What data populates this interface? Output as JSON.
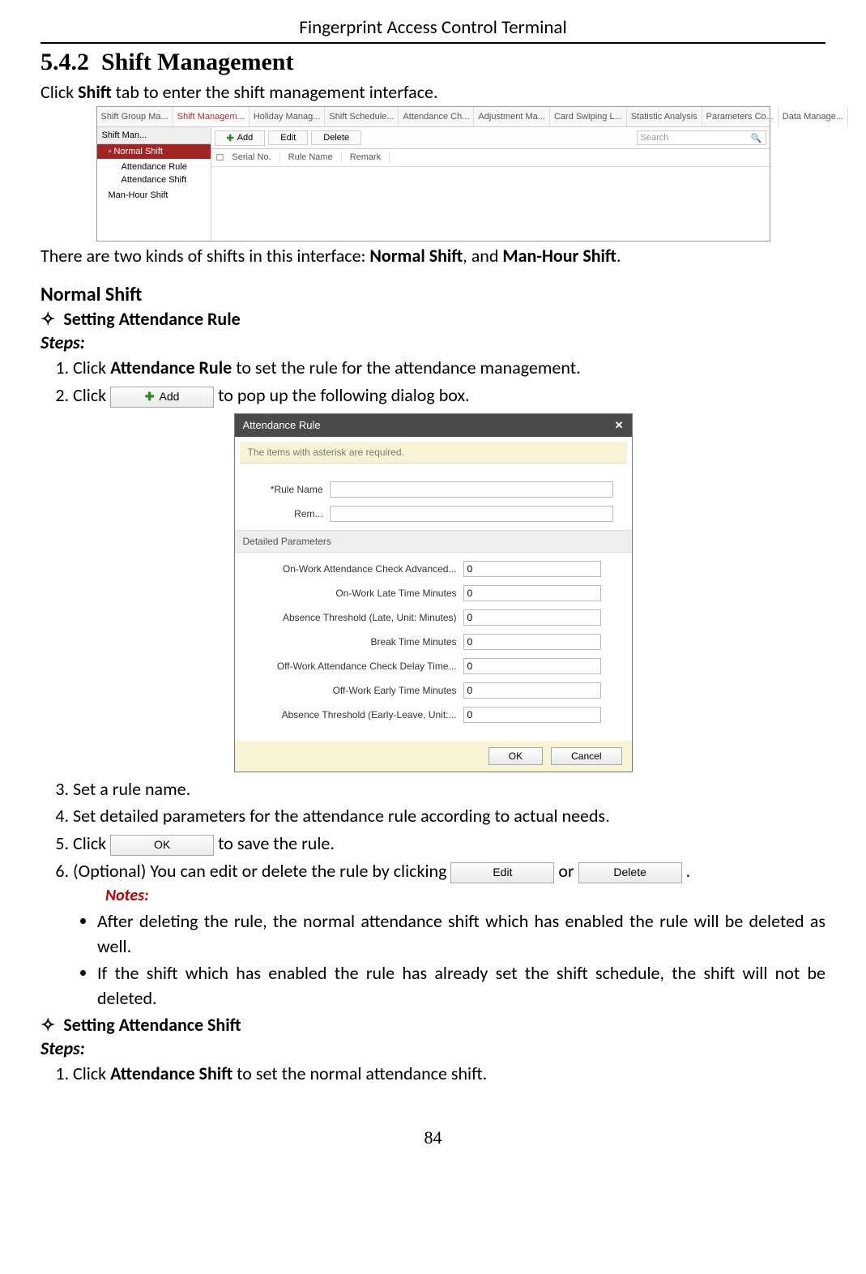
{
  "header": {
    "title": "Fingerprint Access Control Terminal"
  },
  "section": {
    "number": "5.4.2",
    "title": "Shift Management",
    "intro_prefix": "Click ",
    "intro_bold": "Shift",
    "intro_suffix": " tab to enter the shift management interface."
  },
  "shot1": {
    "tabs": [
      "Shift Group Ma...",
      "Shift Managem...",
      "Holiday Manag...",
      "Shift Schedule...",
      "Attendance Ch...",
      "Adjustment Ma...",
      "Card Swiping L...",
      "Statistic Analysis",
      "Parameters Co...",
      "Data Manage..."
    ],
    "active_tab_index": 1,
    "left_header": "Shift Man...",
    "tree": {
      "root": "Normal Shift",
      "children": [
        "Attendance Rule",
        "Attendance Shift"
      ],
      "sibling": "Man-Hour Shift"
    },
    "toolbar": {
      "add": "Add",
      "edit": "Edit",
      "delete": "Delete",
      "search_placeholder": "Search"
    },
    "columns": [
      "Serial No.",
      "Rule Name",
      "Remark"
    ]
  },
  "after_shot1": {
    "prefix": "There are two kinds of shifts in this interface: ",
    "b1": "Normal Shift",
    "mid": ", and ",
    "b2": "Man-Hour Shift",
    "suffix": "."
  },
  "normal_shift_heading": "Normal Shift",
  "setting_rule_heading": "Setting Attendance Rule",
  "steps_label": "Steps:",
  "steps1": {
    "s1_prefix": "Click ",
    "s1_bold": "Attendance Rule",
    "s1_suffix": " to set the rule for the attendance management.",
    "s2_prefix": "Click ",
    "s2_suffix": " to pop up the following dialog box.",
    "s3": "Set a rule name.",
    "s4": "Set detailed parameters for the attendance rule according to actual needs.",
    "s5_prefix": "Click ",
    "s5_suffix": " to save the rule.",
    "s6_prefix": "(Optional) You can edit or delete the rule by clicking ",
    "s6_mid": " or ",
    "s6_suffix": "."
  },
  "inline_buttons": {
    "add": "Add",
    "ok": "OK",
    "edit": "Edit",
    "delete": "Delete"
  },
  "dialog": {
    "title": "Attendance Rule",
    "info": "The items with asterisk are required.",
    "rule_name_label": "*Rule Name",
    "remark_label": "Rem...",
    "section_header": "Detailed Parameters",
    "params": [
      {
        "label": "On-Work Attendance Check Advanced...",
        "value": "0"
      },
      {
        "label": "On-Work Late Time Minutes",
        "value": "0"
      },
      {
        "label": "Absence Threshold (Late, Unit: Minutes)",
        "value": "0"
      },
      {
        "label": "Break Time Minutes",
        "value": "0"
      },
      {
        "label": "Off-Work Attendance Check Delay Time...",
        "value": "0"
      },
      {
        "label": "Off-Work Early Time Minutes",
        "value": "0"
      },
      {
        "label": "Absence Threshold (Early-Leave, Unit:...",
        "value": "0"
      }
    ],
    "ok": "OK",
    "cancel": "Cancel"
  },
  "notes_label": "Notes:",
  "notes": [
    "After deleting the rule, the normal attendance shift which has enabled the rule will be deleted as well.",
    "If the shift which has enabled the rule has already set the shift schedule, the shift will not be deleted."
  ],
  "setting_shift_heading": "Setting Attendance Shift",
  "steps2": {
    "s1_prefix": "Click ",
    "s1_bold": "Attendance Shift",
    "s1_suffix": " to set the normal attendance shift."
  },
  "page_number": "84"
}
